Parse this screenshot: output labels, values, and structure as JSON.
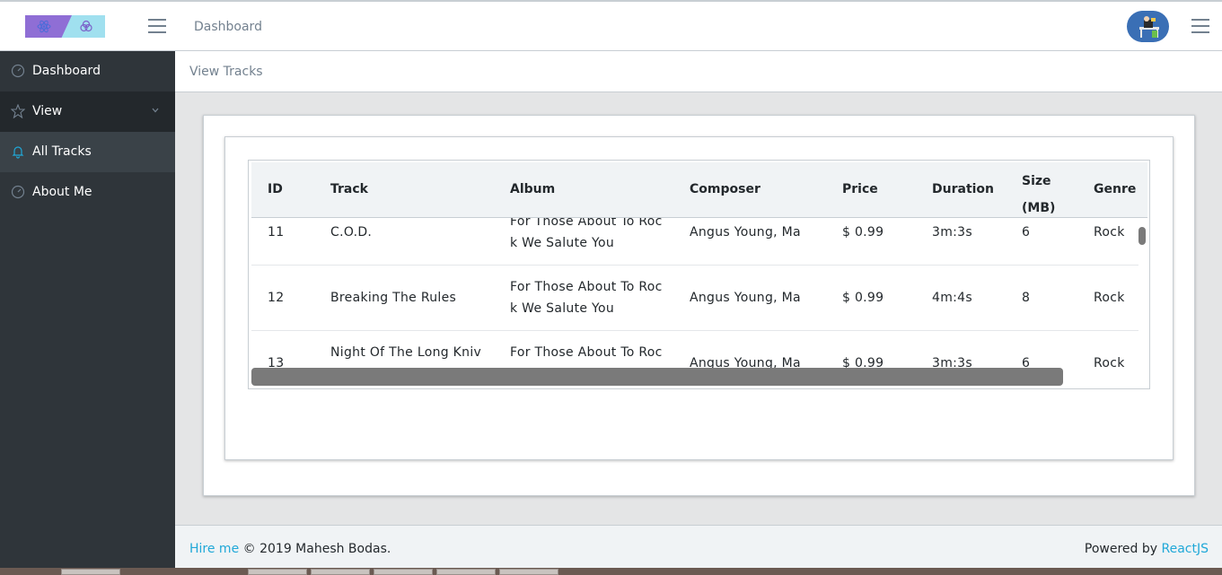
{
  "header": {
    "nav_link": "Dashboard"
  },
  "sidebar": {
    "items": [
      {
        "label": "Dashboard",
        "icon": "speedometer-icon"
      },
      {
        "label": "View",
        "icon": "star-icon"
      },
      {
        "label": "All Tracks",
        "icon": "bell-icon"
      },
      {
        "label": "About Me",
        "icon": "speedometer-icon"
      }
    ]
  },
  "breadcrumb": {
    "current": "View Tracks"
  },
  "table": {
    "columns": [
      "ID",
      "Track",
      "Album",
      "Composer",
      "Price",
      "Duration",
      "Size\n(MB)",
      "Genre"
    ],
    "rows": [
      {
        "id": "11",
        "track": "C.O.D.",
        "album": "For Those About To Rock We Salute You",
        "composer": "Angus Young, Ma",
        "price": "$ 0.99",
        "duration": "3m:3s",
        "size": "6",
        "genre": "Rock"
      },
      {
        "id": "12",
        "track": "Breaking The Rules",
        "album": "For Those About To Rock We Salute You",
        "composer": "Angus Young, Ma",
        "price": "$ 0.99",
        "duration": "4m:4s",
        "size": "8",
        "genre": "Rock"
      },
      {
        "id": "13",
        "track": "Night Of The Long Kniv",
        "album": "For Those About To Roc",
        "composer": "Angus Young, Ma",
        "price": "$ 0.99",
        "duration": "3m:3s",
        "size": "6",
        "genre": "Rock"
      }
    ]
  },
  "footer": {
    "hire_link": "Hire me",
    "copyright": "© 2019 Mahesh Bodas.",
    "powered_by": "Powered by",
    "framework_link": "ReactJS"
  },
  "colors": {
    "sidebar_bg": "#2f353a",
    "link": "#20a8d8",
    "brand_purple": "#8f6ed5",
    "brand_cyan": "#a0e0ef"
  }
}
